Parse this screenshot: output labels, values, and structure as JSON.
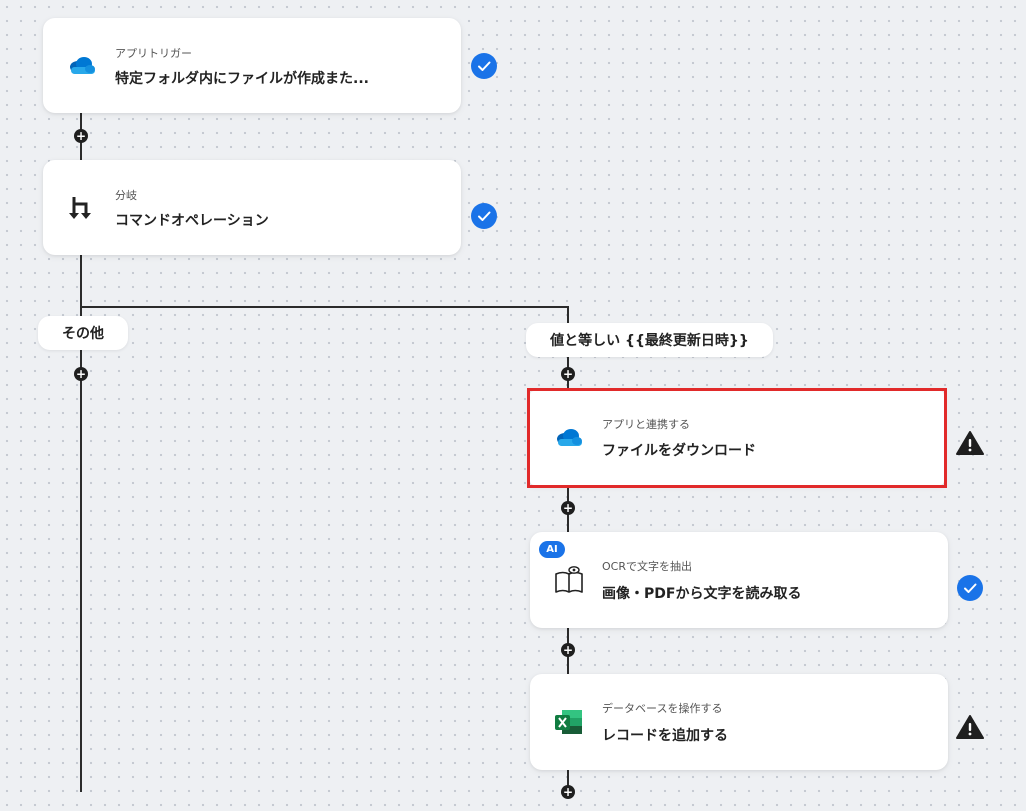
{
  "steps": [
    {
      "subtitle": "アプリトリガー",
      "title": "特定フォルダ内にファイルが作成また...",
      "icon": "onedrive-icon",
      "status": "complete"
    },
    {
      "subtitle": "分岐",
      "title": "コマンドオペレーション",
      "icon": "branch-icon",
      "status": "complete"
    },
    {
      "subtitle": "アプリと連携する",
      "title": "ファイルをダウンロード",
      "icon": "onedrive-icon",
      "status": "warning",
      "selected": true
    },
    {
      "subtitle": "OCRで文字を抽出",
      "title": "画像・PDFから文字を読み取る",
      "icon": "ocr-book-icon",
      "status": "complete",
      "badge": "AI"
    },
    {
      "subtitle": "データベースを操作する",
      "title": "レコードを追加する",
      "icon": "excel-icon",
      "status": "warning"
    }
  ],
  "branches": {
    "other_label": "その他",
    "condition_label": "値と等しい {{最終更新日時}}"
  },
  "colors": {
    "accent": "#1a73e8",
    "highlight": "#e12a2a",
    "connector": "#2b2b2b",
    "onedrive": "#0a6fd6",
    "excel": "#107c41"
  }
}
